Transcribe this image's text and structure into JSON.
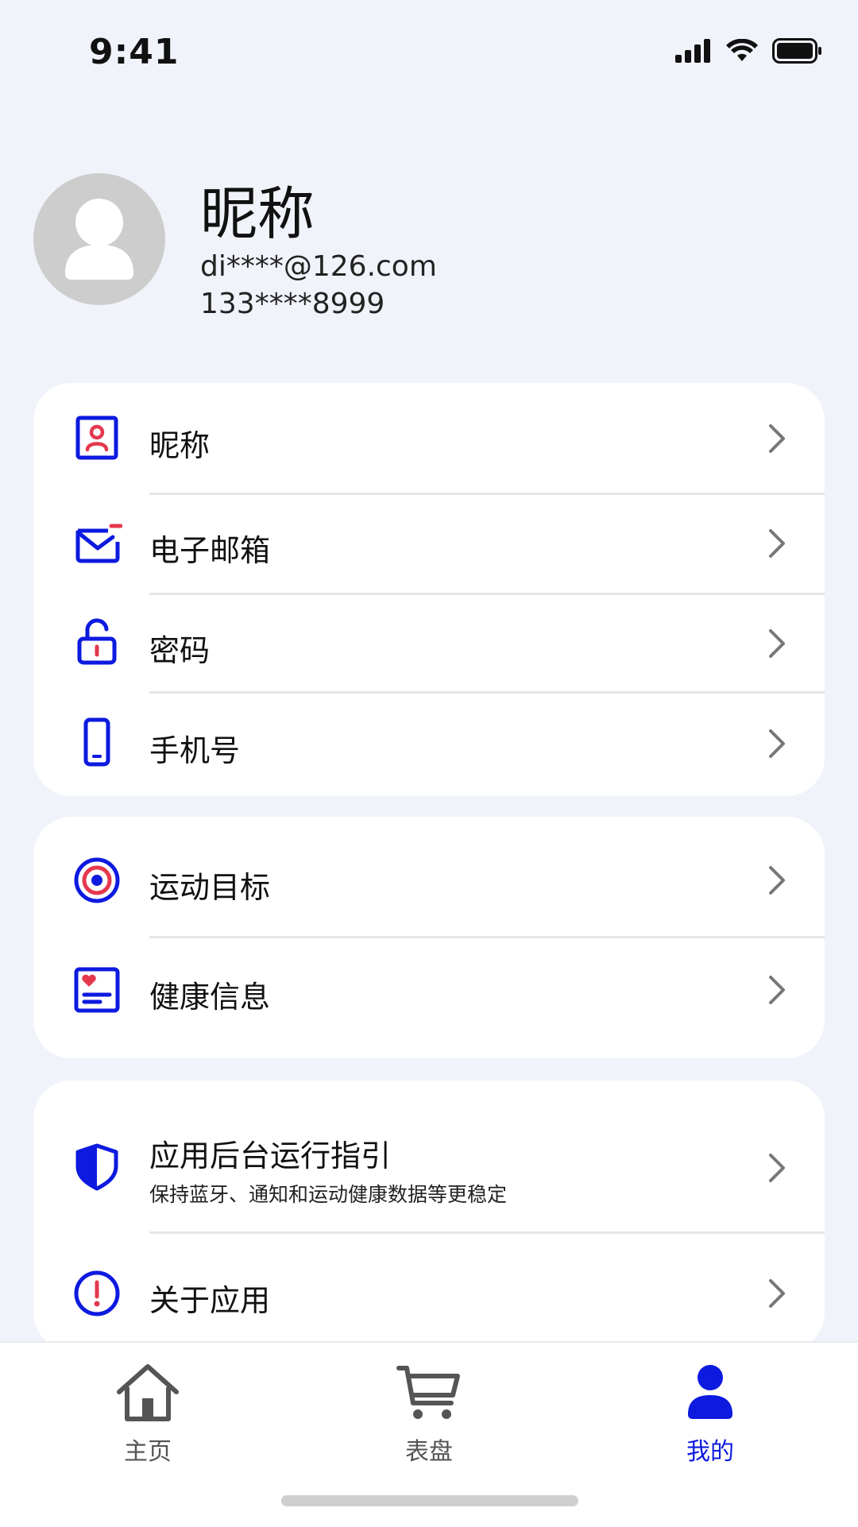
{
  "status_bar": {
    "time": "9:41",
    "icons": [
      "cellular-signal-icon",
      "wifi-icon",
      "battery-icon"
    ]
  },
  "profile": {
    "nickname": "昵称",
    "email": "di****@126.com",
    "phone": "133****8999",
    "avatar_icon": "user-silhouette-icon"
  },
  "sections": {
    "account": [
      {
        "label": "昵称",
        "icon": "user-badge-icon"
      },
      {
        "label": "电子邮箱",
        "icon": "mail-icon"
      },
      {
        "label": "密码",
        "icon": "unlock-icon"
      },
      {
        "label": "手机号",
        "icon": "phone-icon"
      }
    ],
    "health": [
      {
        "label": "运动目标",
        "icon": "target-icon"
      },
      {
        "label": "健康信息",
        "icon": "health-card-icon"
      }
    ],
    "app": [
      {
        "label": "应用后台运行指引",
        "subtitle": "保持蓝牙、通知和运动健康数据等更稳定",
        "icon": "shield-icon"
      },
      {
        "label": "关于应用",
        "icon": "info-icon"
      }
    ]
  },
  "tabbar": {
    "tabs": [
      {
        "label": "主页",
        "icon": "home-icon"
      },
      {
        "label": "表盘",
        "icon": "cart-icon"
      },
      {
        "label": "我的",
        "icon": "person-icon"
      }
    ],
    "active": "我的"
  },
  "colors": {
    "background": "#f1f3fb",
    "accent_blue": "#0d1adf",
    "accent_red": "#e5384d",
    "avatar_gray": "#cdcdcd",
    "tab_gray": "#555555"
  }
}
